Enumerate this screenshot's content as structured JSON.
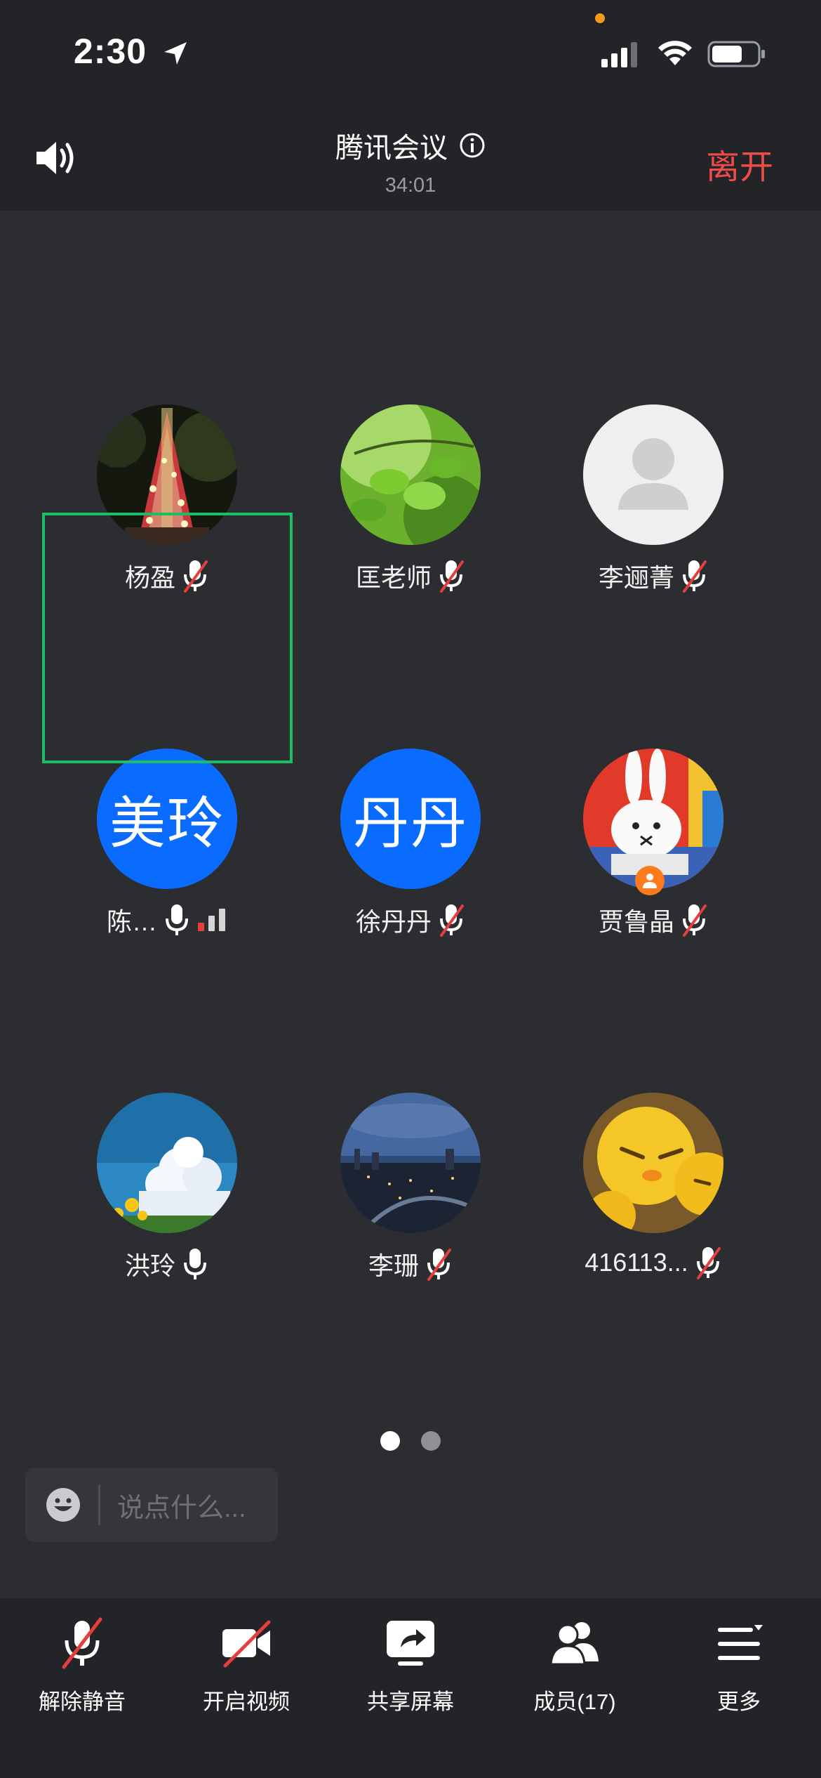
{
  "status_bar": {
    "time": "2:30"
  },
  "header": {
    "title": "腾讯会议",
    "timer": "34:01",
    "leave_label": "离开"
  },
  "participants": [
    {
      "name": "杨盈",
      "mic": "muted",
      "avatar": "photo-tower-lights"
    },
    {
      "name": "匡老师",
      "mic": "muted",
      "avatar": "photo-green-leaves"
    },
    {
      "name": "李逦菁",
      "mic": "muted",
      "avatar": "default-person"
    },
    {
      "name": "陈…",
      "avatar_text": "美玲",
      "mic": "on",
      "signal": "weak",
      "active_speaker": true
    },
    {
      "name": "徐丹丹",
      "avatar_text": "丹丹",
      "mic": "muted"
    },
    {
      "name": "贾鲁晶",
      "mic": "muted",
      "avatar": "photo-bunny",
      "host_badge": true
    },
    {
      "name": "洪玲",
      "mic": "on",
      "avatar": "photo-sky-sunflower"
    },
    {
      "name": "李珊",
      "mic": "muted",
      "avatar": "photo-city-night"
    },
    {
      "name": "416113...",
      "mic": "muted",
      "avatar": "photo-yellow-chicks"
    }
  ],
  "pager": {
    "pages": 2,
    "current": 1
  },
  "chat": {
    "placeholder": "说点什么..."
  },
  "toolbar": {
    "unmute": "解除静音",
    "start_video": "开启视频",
    "share_screen": "共享屏幕",
    "members": "成员(17)",
    "more": "更多"
  },
  "colors": {
    "background": "#2b2d31",
    "header": "#232427",
    "leave": "#ef4b4b",
    "avatar_blue": "#0a6cff",
    "active_frame": "#1dbd63",
    "muted_slash": "#e53e3e"
  }
}
